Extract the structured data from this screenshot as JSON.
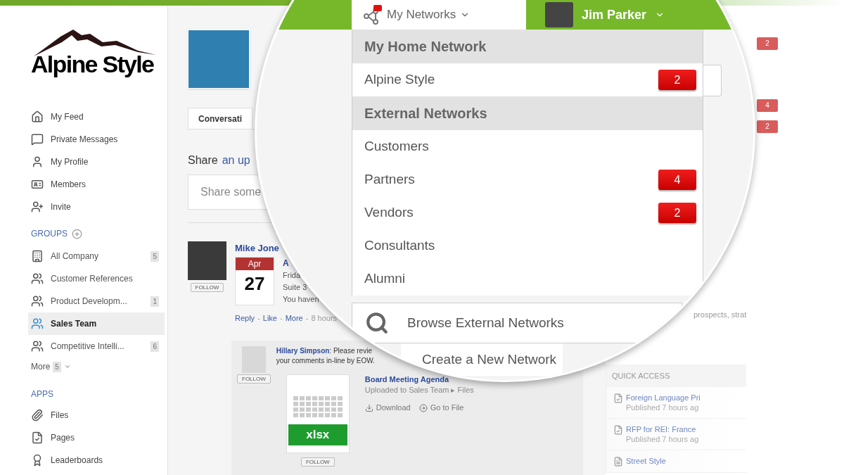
{
  "sidebar": {
    "logo": "Alpine Style",
    "nav": [
      {
        "label": "My Feed"
      },
      {
        "label": "Private Messages"
      },
      {
        "label": "My Profile"
      },
      {
        "label": "Members"
      },
      {
        "label": "Invite"
      }
    ],
    "groups_heading": "GROUPS",
    "groups": [
      {
        "label": "All Company",
        "count": "5",
        "selected": false
      },
      {
        "label": "Customer References",
        "selected": false
      },
      {
        "label": "Product Developm...",
        "count": "1",
        "selected": false
      },
      {
        "label": "Sales Team",
        "selected": true
      },
      {
        "label": "Competitive Intelli...",
        "count": "6",
        "selected": false
      }
    ],
    "groups_more": {
      "label": "More",
      "count": "5"
    },
    "apps_heading": "APPS",
    "apps": [
      {
        "label": "Files"
      },
      {
        "label": "Pages"
      },
      {
        "label": "Leaderboards"
      }
    ]
  },
  "main": {
    "tab": "Conversati",
    "share_prompt": "Share",
    "share_link": "an up",
    "share_placeholder": "Share some",
    "post": {
      "author": "Mike Jone",
      "follow": "FOLLOW",
      "month": "Apr",
      "day": "27",
      "title": "A",
      "lines": [
        "Frida",
        "Suite 3",
        "You haven"
      ],
      "actions": [
        "Reply",
        "Like",
        "More"
      ],
      "separator": "-",
      "time": "8 hours"
    },
    "reply": {
      "text": "**Hillary Simpson**: Please revie",
      "text_2": "your comments in-line by EOW.",
      "follow": "FOLLOW",
      "file_type": "xlsx",
      "file_follow": "FOLLOW",
      "file_name": "Board Meeting Agenda",
      "file_location": "Uploaded to Sales Team ▸ Files",
      "download": "Download",
      "go_to_file": "Go to File"
    }
  },
  "right": {
    "badges": [
      "2",
      "4",
      "2"
    ],
    "fragment": "prospects, strat",
    "quick_access": {
      "title": "QUICK ACCESS",
      "items": [
        {
          "title": "Foreign Language Pri",
          "meta": "Published 7 hours ag"
        },
        {
          "title": "RFP for REI: France",
          "meta": "Published 7 hours ag"
        },
        {
          "title": "Street Style"
        }
      ]
    }
  },
  "lens": {
    "networks_tab": "My Networks",
    "user": "Jim Parker",
    "menu": [
      {
        "kind": "header",
        "label": "My Home Network"
      },
      {
        "kind": "item",
        "label": "Alpine Style",
        "badge": "2"
      },
      {
        "kind": "header",
        "label": "External Networks"
      },
      {
        "kind": "item",
        "label": "Customers"
      },
      {
        "kind": "item",
        "label": "Partners",
        "badge": "4"
      },
      {
        "kind": "item",
        "label": "Vendors",
        "badge": "2"
      },
      {
        "kind": "item",
        "label": "Consultants"
      },
      {
        "kind": "item",
        "label": "Alumni"
      }
    ],
    "actions": [
      {
        "kind": "browse",
        "label": "Browse External Networks"
      },
      {
        "kind": "create",
        "label": "Create a New Network"
      }
    ]
  }
}
